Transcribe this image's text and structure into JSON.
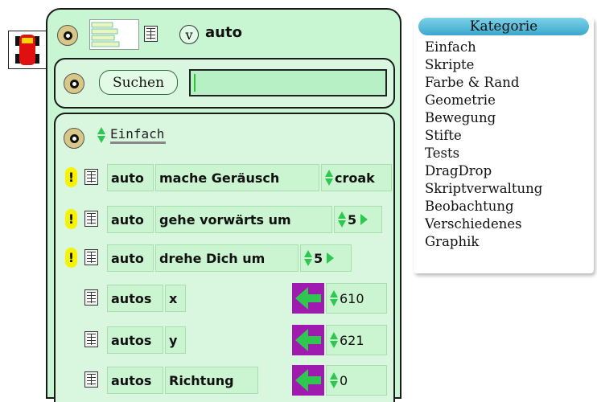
{
  "viewer": {
    "object_name": "auto",
    "v_label": "v",
    "search_button": "Suchen",
    "search_value": "",
    "category_selected": "Einfach"
  },
  "rows": [
    {
      "has_alert": true,
      "subject": "auto",
      "command": "mache Geräusch",
      "argument": "croak",
      "has_play": false
    },
    {
      "has_alert": true,
      "subject": "auto",
      "command": "gehe vorwärts um",
      "argument": "5",
      "has_play": true
    },
    {
      "has_alert": true,
      "subject": "auto",
      "command": "drehe Dich um",
      "argument": "5",
      "has_play": true
    }
  ],
  "properties": [
    {
      "subject": "autos",
      "property": "x",
      "value": "610"
    },
    {
      "subject": "autos",
      "property": "y",
      "value": "621"
    },
    {
      "subject": "autos",
      "property": "Richtung",
      "value": "0"
    }
  ],
  "categories": {
    "header": "Kategorie",
    "items": [
      "Einfach",
      "Skripte",
      "Farbe & Rand",
      "Geometrie",
      "Bewegung",
      "Stifte",
      "Tests",
      "DragDrop",
      "Skriptverwaltung",
      "Beobachtung",
      "Verschiedenes",
      "Graphik"
    ]
  },
  "colors": {
    "viewer_bg": "#c8f5d2",
    "arrow_tile": "#a01ab0",
    "alert": "#f7f200",
    "header_blue": "#3aa8cc"
  }
}
